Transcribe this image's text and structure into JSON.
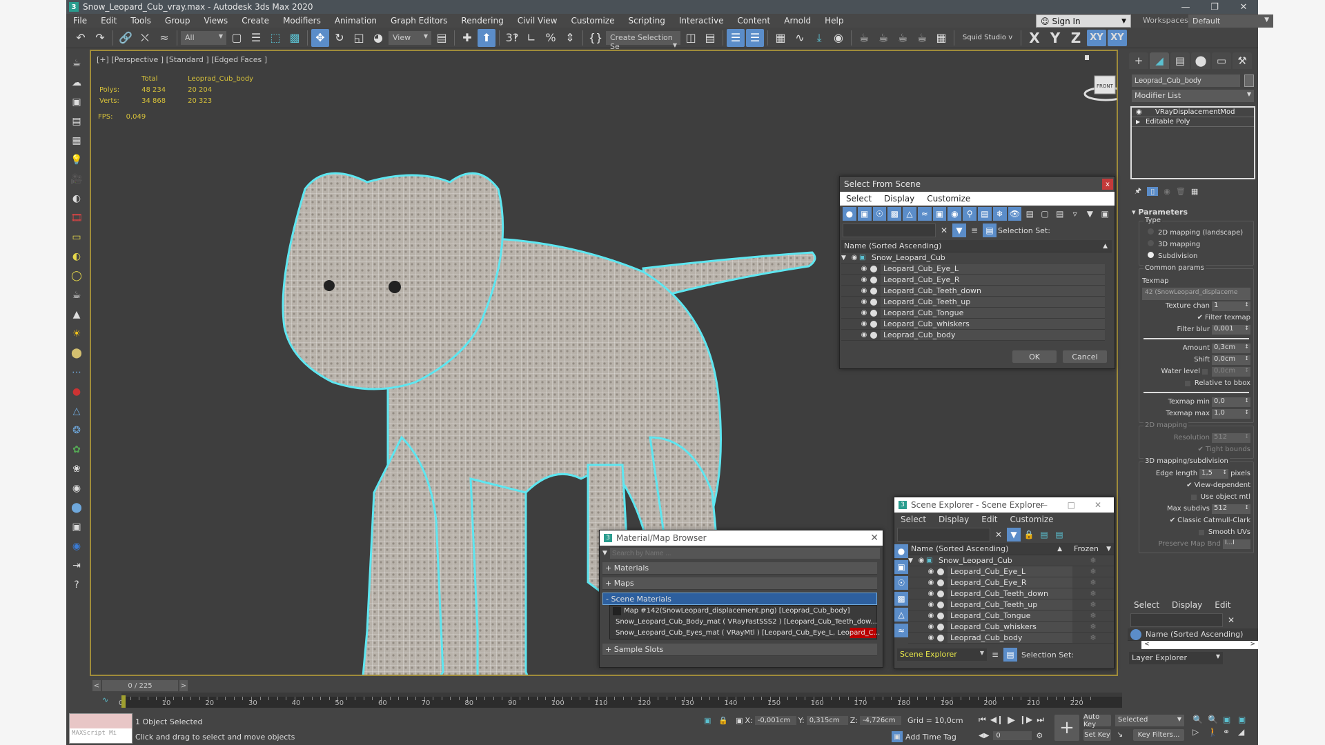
{
  "window": {
    "title": "Snow_Leopard_Cub_vray.max - Autodesk 3ds Max 2020",
    "app_icon": "3",
    "controls": [
      "minimize-icon",
      "restore-icon",
      "close-icon"
    ]
  },
  "menu": [
    "File",
    "Edit",
    "Tools",
    "Group",
    "Views",
    "Create",
    "Modifiers",
    "Animation",
    "Graph Editors",
    "Rendering",
    "Civil View",
    "Customize",
    "Scripting",
    "Interactive",
    "Content",
    "Arnold",
    "Help"
  ],
  "signin": {
    "label": "Sign In"
  },
  "workspaces": {
    "label": "Workspaces:",
    "value": "Default"
  },
  "toolbar": {
    "selection_filter": "All",
    "ref_coord": "View",
    "named_selection": "Create Selection Se",
    "squid": "Squid Studio v",
    "axis_x": "X",
    "axis_y": "Y",
    "axis_z": "Z",
    "axis_xy": "XY",
    "axis_xyq": "XY"
  },
  "viewport": {
    "label": "[+] [Perspective ] [Standard ] [Edged Faces ]",
    "stats": {
      "col_total": "Total",
      "col_object": "Leoprad_Cub_body",
      "polys_label": "Polys:",
      "polys_total": "48 234",
      "polys_obj": "20 204",
      "verts_label": "Verts:",
      "verts_total": "34 868",
      "verts_obj": "20 323"
    },
    "fps_label": "FPS:",
    "fps": "0,049",
    "viewcube_face": "FRONT"
  },
  "select_from_scene": {
    "title": "Select From Scene",
    "menu": [
      "Select",
      "Display",
      "Customize"
    ],
    "selection_set_label": "Selection Set:",
    "column": "Name (Sorted Ascending)",
    "root": "Snow_Leopard_Cub",
    "items": [
      "Leopard_Cub_Eye_L",
      "Leopard_Cub_Eye_R",
      "Leopard_Cub_Teeth_down",
      "Leopard_Cub_Teeth_up",
      "Leopard_Cub_Tongue",
      "Leopard_Cub_whiskers",
      "Leoprad_Cub_body"
    ],
    "ok": "OK",
    "cancel": "Cancel"
  },
  "material_browser": {
    "title": "Material/Map Browser",
    "search_placeholder": "Search by Name ...",
    "sections": {
      "materials": "+ Materials",
      "maps": "+ Maps",
      "scene_materials": "- Scene Materials",
      "sample_slots": "+ Sample Slots"
    },
    "scene_items": [
      "Map #142(SnowLeopard_displacement.png) [Leoprad_Cub_body]",
      "Snow_Leopard_Cub_Body_mat ( VRayFastSSS2 ) [Leopard_Cub_Teeth_dow...",
      "Snow_Leopard_Cub_Eyes_mat ( VRayMtl ) [Leopard_Cub_Eye_L, Leopard_C..."
    ]
  },
  "scene_explorer": {
    "title": "Scene Explorer - Scene Explorer",
    "menu": [
      "Select",
      "Display",
      "Edit",
      "Customize"
    ],
    "column": "Name (Sorted Ascending)",
    "frozen_column": "Frozen",
    "root": "Snow_Leopard_Cub",
    "items": [
      "Leopard_Cub_Eye_L",
      "Leopard_Cub_Eye_R",
      "Leopard_Cub_Teeth_down",
      "Leopard_Cub_Teeth_up",
      "Leopard_Cub_Tongue",
      "Leopard_Cub_whiskers",
      "Leoprad_Cub_body"
    ],
    "explorer_name": "Scene Explorer",
    "selection_set_label": "Selection Set:"
  },
  "command_panel": {
    "object_name": "Leoprad_Cub_body",
    "modifier_list": "Modifier List",
    "stack": [
      "VRayDisplacementMod",
      "Editable Poly"
    ],
    "rollout": "Parameters",
    "type_label": "Type",
    "type_options": [
      {
        "label": "2D mapping (landscape)",
        "selected": false
      },
      {
        "label": "3D mapping",
        "selected": false
      },
      {
        "label": "Subdivision",
        "selected": true
      }
    ],
    "common_params": "Common params",
    "texmap_label": "Texmap",
    "texmap_value": "42 (SnowLeopard_displaceme",
    "texture_chan_label": "Texture chan",
    "texture_chan": "1",
    "filter_texmap": "Filter texmap",
    "filter_blur_label": "Filter blur",
    "filter_blur": "0,001",
    "amount_label": "Amount",
    "amount": "0,3cm",
    "shift_label": "Shift",
    "shift": "0,0cm",
    "water_level_label": "Water level",
    "water_level": "0,0cm",
    "relative_bbox": "Relative to bbox",
    "texmap_min_label": "Texmap min",
    "texmap_min": "0,0",
    "texmap_max_label": "Texmap max",
    "texmap_max": "1,0",
    "mapping2d": "2D mapping",
    "resolution_label": "Resolution",
    "resolution": "512",
    "tight_bounds": "Tight bounds",
    "mapping3d": "3D mapping/subdivision",
    "edge_length_label": "Edge length",
    "edge_length": "1,5",
    "edge_units": "pixels",
    "view_dependent": "View-dependent",
    "use_object_mtl": "Use object mtl",
    "max_subdivs_label": "Max subdivs",
    "max_subdivs": "512",
    "classic_catmull": "Classic Catmull-Clark",
    "smooth_uvs": "Smooth UVs",
    "preserve_map": "Preserve Map Bnd",
    "preserve_value": "I...I"
  },
  "layer_panel": {
    "menu": [
      "Select",
      "Display",
      "Edit"
    ],
    "column": "Name (Sorted Ascending)",
    "explorer": "Layer Explorer"
  },
  "timeline": {
    "frame": "0 / 225",
    "ticks": [
      "0",
      "10",
      "20",
      "30",
      "40",
      "50",
      "60",
      "70",
      "80",
      "90",
      "100",
      "110",
      "120",
      "130",
      "140",
      "150",
      "160",
      "170",
      "180",
      "190",
      "200",
      "210",
      "220"
    ]
  },
  "status": {
    "maxscript": "MAXScript Mi",
    "selected": "1 Object Selected",
    "prompt": "Click and drag to select and move objects",
    "x_label": "X:",
    "x": "-0,001cm",
    "y_label": "Y:",
    "y": "0,315cm",
    "z_label": "Z:",
    "z": "-4,726cm",
    "grid": "Grid = 10,0cm",
    "add_time_tag": "Add Time Tag",
    "current_frame": "0",
    "auto_key": "Auto Key",
    "set_key": "Set Key",
    "key_mode": "Selected",
    "key_filters": "Key Filters..."
  }
}
